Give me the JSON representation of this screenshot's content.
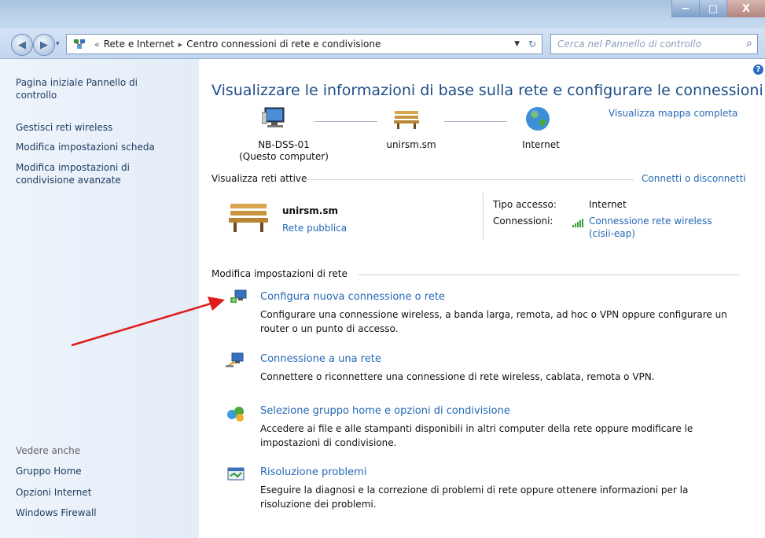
{
  "window": {
    "buttons": {
      "minimize": "−",
      "maximize": "□",
      "close": "X"
    }
  },
  "navbar": {
    "breadcrumb": [
      "«",
      "Rete e Internet",
      "▸",
      "Centro connessioni di rete e condivisione"
    ],
    "search_placeholder": "Cerca nel Pannello di controllo"
  },
  "sidebar": {
    "home_link": "Pagina iniziale Pannello di controllo",
    "links": [
      "Gestisci reti wireless",
      "Modifica impostazioni scheda",
      "Modifica impostazioni di condivisione avanzate"
    ],
    "see_also_title": "Vedere anche",
    "see_also": [
      "Gruppo Home",
      "Opzioni Internet",
      "Windows Firewall"
    ]
  },
  "main": {
    "title": "Visualizzare le informazioni di base sulla rete e configurare le connessioni",
    "map_link": "Visualizza mappa completa",
    "map": {
      "computer_name": "NB-DSS-01",
      "computer_sub": "(Questo computer)",
      "network_name": "unirsm.sm",
      "internet": "Internet"
    },
    "active_section": "Visualizza reti attive",
    "connect_link": "Connetti o disconnetti",
    "active": {
      "name": "unirsm.sm",
      "type_link": "Rete pubblica",
      "access_label": "Tipo accesso:",
      "access_value": "Internet",
      "conn_label": "Connessioni:",
      "conn_link_1": "Connessione rete wireless",
      "conn_link_2": "(cisii-eap)"
    },
    "settings_section": "Modifica impostazioni di rete",
    "tasks": [
      {
        "title": "Configura nuova connessione o rete",
        "desc_1": "Configurare una connessione wireless, a banda larga, remota, ad hoc o VPN oppure configurare un",
        "desc_2": "router o un punto di accesso."
      },
      {
        "title": "Connessione a una rete",
        "desc_1": "Connettere o riconnettere una connessione di rete wireless, cablata, remota o VPN.",
        "desc_2": ""
      },
      {
        "title": "Selezione gruppo home e opzioni di condivisione",
        "desc_1": "Accedere ai file e alle stampanti disponibili in altri computer della rete oppure modificare le",
        "desc_2": "impostazioni di condivisione."
      },
      {
        "title": "Risoluzione problemi",
        "desc_1": "Eseguire la diagnosi e la correzione di problemi di rete oppure ottenere informazioni per la",
        "desc_2": "risoluzione dei problemi."
      }
    ]
  },
  "colors": {
    "link": "#2468b5",
    "title": "#1e4f8a",
    "arrow": "#e01b1b",
    "sidebar_bg": "#e8f0f9"
  }
}
